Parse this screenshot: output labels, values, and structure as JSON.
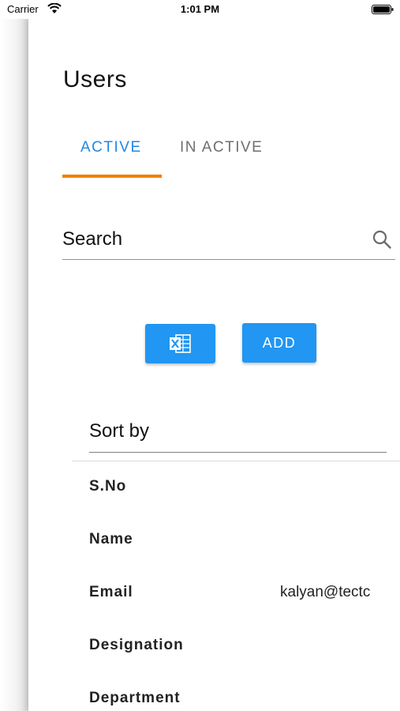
{
  "status_bar": {
    "carrier": "Carrier",
    "time": "1:01 PM"
  },
  "header": {
    "title": "Users"
  },
  "tabs": [
    {
      "label": "ACTIVE",
      "selected": true
    },
    {
      "label": "IN ACTIVE",
      "selected": false
    }
  ],
  "search": {
    "placeholder": "Search",
    "value": ""
  },
  "actions": {
    "excel_icon": "excel-icon",
    "add_label": "ADD"
  },
  "sort": {
    "label": "Sort by"
  },
  "fields": [
    {
      "label": "S.No",
      "value": ""
    },
    {
      "label": "Name",
      "value": ""
    },
    {
      "label": "Email",
      "value": "kalyan@tectc"
    },
    {
      "label": "Designation",
      "value": ""
    },
    {
      "label": "Department",
      "value": ""
    }
  ],
  "colors": {
    "accent": "#2196f3",
    "tab_active": "#1e88e5",
    "tab_indicator": "#f57c00"
  }
}
